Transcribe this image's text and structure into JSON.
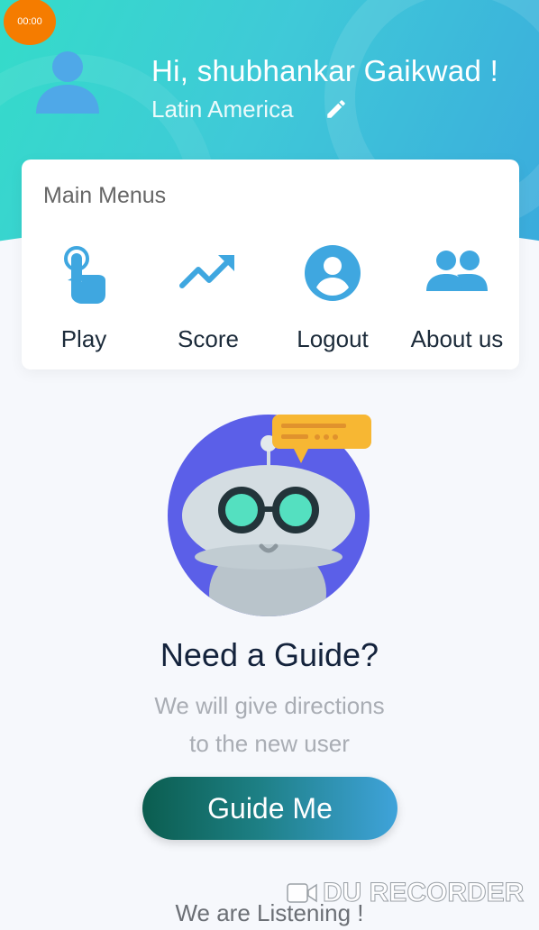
{
  "recorder": {
    "timer": "00:00",
    "watermark": "DU RECORDER"
  },
  "header": {
    "greeting": "Hi, shubhankar Gaikwad !",
    "region": "Latin America"
  },
  "menu": {
    "title": "Main Menus",
    "items": [
      {
        "label": "Play",
        "icon": "tap-hand-icon"
      },
      {
        "label": "Score",
        "icon": "trending-up-icon"
      },
      {
        "label": "Logout",
        "icon": "account-circle-icon"
      },
      {
        "label": "About us",
        "icon": "group-icon"
      }
    ]
  },
  "guide": {
    "title": "Need a Guide?",
    "description_line1": "We will give directions",
    "description_line2": "to the new user",
    "button_label": "Guide Me"
  },
  "footer": {
    "text": "We are Listening !"
  },
  "colors": {
    "header_start": "#34dcc9",
    "header_end": "#3aa9dd",
    "icon_blue": "#3fa7e0",
    "robot_bg": "#5b5fe8",
    "bubble": "#f7b733"
  }
}
